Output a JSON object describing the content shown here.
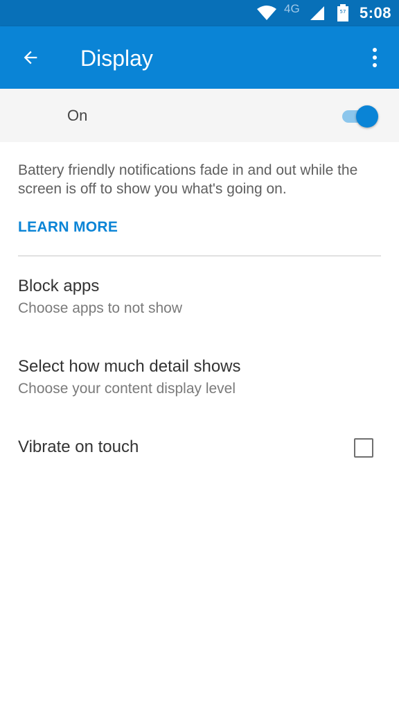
{
  "status_bar": {
    "network": "4G",
    "time": "5:08",
    "battery_level": "57",
    "icons": [
      "wifi-icon",
      "signal-icon",
      "battery-icon"
    ]
  },
  "app_bar": {
    "title": "Display",
    "back_icon": "arrow-left-icon",
    "overflow_icon": "more-vert-icon"
  },
  "master_switch": {
    "label": "On",
    "checked": true
  },
  "description": {
    "text": "Battery friendly notifications fade in and out while the screen is off to show you what's going on.",
    "link_label": "LEARN MORE"
  },
  "settings": {
    "block_apps": {
      "title": "Block apps",
      "summary": "Choose apps to not show"
    },
    "detail_level": {
      "title": "Select how much detail shows",
      "summary": "Choose your content display level"
    },
    "vibrate": {
      "title": "Vibrate on touch",
      "checked": false
    }
  },
  "colors": {
    "status_bar": "#0870b8",
    "app_bar": "#0a84d6",
    "accent": "#0a84d6",
    "switch_track": "#8cc6ec",
    "switch_row_bg": "#f5f5f5"
  }
}
